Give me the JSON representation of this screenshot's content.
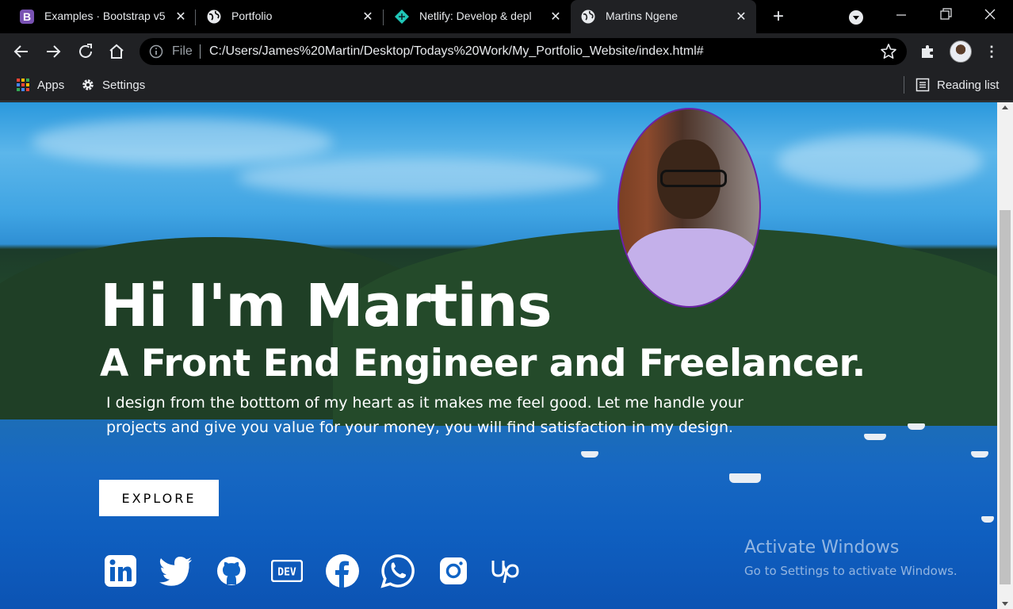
{
  "browser": {
    "tabs": [
      {
        "title": "Examples · Bootstrap v5",
        "icon": "bootstrap-icon",
        "active": false
      },
      {
        "title": "Portfolio",
        "icon": "globe-icon",
        "active": false
      },
      {
        "title": "Netlify: Develop & depl",
        "icon": "netlify-icon",
        "active": false
      },
      {
        "title": "Martins Ngene",
        "icon": "globe-icon",
        "active": true
      }
    ],
    "address": {
      "scheme_label": "File",
      "url": "C:/Users/James%20Martin/Desktop/Todays%20Work/My_Portfolio_Website/index.html#"
    },
    "bookmarks": [
      {
        "label": "Apps",
        "icon": "apps-grid-icon"
      },
      {
        "label": "Settings",
        "icon": "gear-icon"
      }
    ],
    "reading_list": "Reading list"
  },
  "hero": {
    "title": "Hi I'm Martins",
    "subtitle": "A Front End Engineer and Freelancer.",
    "description": "I design from the botttom of my heart as it makes me feel good. Let me handle your projects and give you value for your money, you will find satisfaction in my design.",
    "cta_label": "EXPLORE"
  },
  "socials": [
    {
      "name": "linkedin-icon"
    },
    {
      "name": "twitter-icon"
    },
    {
      "name": "github-icon"
    },
    {
      "name": "dev-icon"
    },
    {
      "name": "facebook-icon"
    },
    {
      "name": "whatsapp-icon"
    },
    {
      "name": "instagram-icon"
    },
    {
      "name": "upwork-icon"
    }
  ],
  "watermark": {
    "line1": "Activate Windows",
    "line2": "Go to Settings to activate Windows."
  },
  "colors": {
    "browser_frame": "#000000",
    "toolbar": "#202124",
    "portrait_border": "#6b21a8",
    "netlify_teal": "#20c6b7",
    "bootstrap_purple": "#7952b3"
  }
}
